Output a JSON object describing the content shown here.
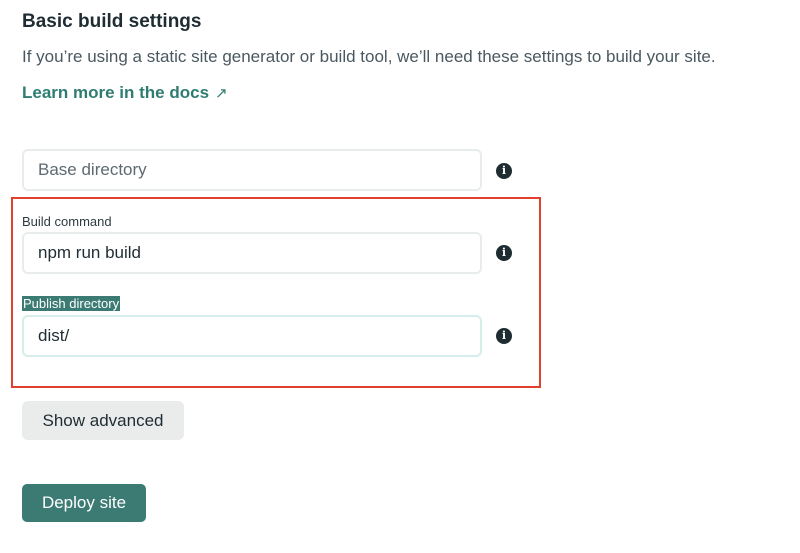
{
  "header": {
    "title": "Basic build settings",
    "description": "If you’re using a static site generator or build tool, we’ll need these settings to build your site.",
    "docs_link": "Learn more in the docs",
    "docs_link_arrow": "↗"
  },
  "fields": {
    "base_directory": {
      "placeholder": "Base directory",
      "value": ""
    },
    "build_command": {
      "label": "Build command",
      "value": "npm run build"
    },
    "publish_directory": {
      "label": "Publish directory",
      "value": "dist/"
    }
  },
  "icons": {
    "info": "i"
  },
  "buttons": {
    "show_advanced": "Show advanced",
    "deploy": "Deploy site"
  },
  "colors": {
    "accent": "#3b7b73",
    "link": "#2f7d72",
    "annotation": "#e0402d"
  }
}
